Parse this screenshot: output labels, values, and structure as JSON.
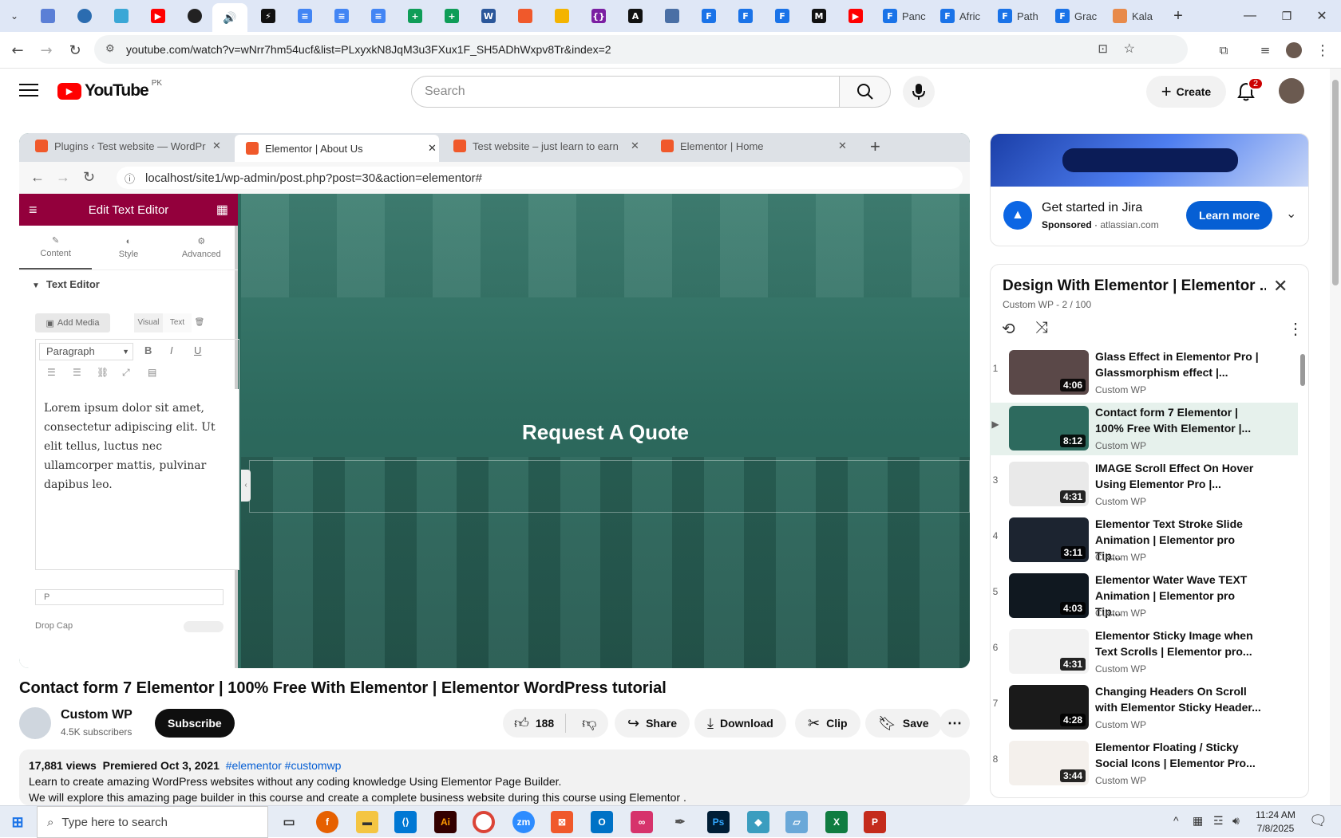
{
  "browser": {
    "url": "youtube.com/watch?v=wNrr7hm54ucf&list=PLxyxkN8JqM3u3FXux1F_SH5ADhWxpv8Tr&index=2",
    "tabs": [
      "Panc",
      "Afric",
      "Path",
      "Grac",
      "Kala"
    ]
  },
  "youtube": {
    "logo": "YouTube",
    "region": "PK",
    "search_placeholder": "Search",
    "create_label": "Create",
    "notif_count": "2"
  },
  "inner_browser": {
    "tabs": [
      "Plugins ‹ Test website — WordPr",
      "Elementor | About Us",
      "Test website – just learn to earn",
      "Elementor | Home"
    ],
    "url": "localhost/site1/wp-admin/post.php?post=30&action=elementor#"
  },
  "elementor": {
    "panel_title": "Edit Text Editor",
    "tabs": [
      "Content",
      "Style",
      "Advanced"
    ],
    "section": "Text Editor",
    "add_media": "Add Media",
    "visual": "Visual",
    "text": "Text",
    "format": "Paragraph",
    "body": "Lorem ipsum dolor sit amet, consectetur adipiscing elit. Ut elit tellus, luctus nec ullamcorper mattis, pulvinar dapibus leo.",
    "path": "P",
    "drop_cap": "Drop Cap",
    "hero_heading": "Request A Quote"
  },
  "video": {
    "title": "Contact form 7 Elementor | 100% Free With Elementor | Elementor WordPress tutorial",
    "channel": "Custom WP",
    "subscribers": "4.5K subscribers",
    "subscribe": "Subscribe",
    "likes": "188",
    "share": "Share",
    "download": "Download",
    "clip": "Clip",
    "save": "Save",
    "views": "17,881 views",
    "premiered": "Premiered Oct 3, 2021",
    "tags": "#elementor #customwp",
    "desc1": "Learn to create amazing WordPress websites without any coding knowledge Using Elementor Page Builder.",
    "desc2": "We will explore this amazing page builder in this course and create a complete business website during this course using Elementor ."
  },
  "ad": {
    "title": "Get started in Jira",
    "sponsored": "Sponsored",
    "domain": "atlassian.com",
    "cta": "Learn more"
  },
  "playlist": {
    "title": "Design With Elementor | Elementor ...",
    "meta": "Custom WP - 2 / 100",
    "items": [
      {
        "num": "1",
        "title": "Glass Effect in Elementor Pro | Glassmorphism effect |...",
        "channel": "Custom WP",
        "dur": "4:06",
        "color": "#5a4848"
      },
      {
        "num": "▶",
        "title": "Contact form 7 Elementor | 100% Free With Elementor |...",
        "channel": "Custom WP",
        "dur": "8:12",
        "color": "#2d6a5e"
      },
      {
        "num": "3",
        "title": "IMAGE Scroll Effect On Hover Using Elementor Pro |...",
        "channel": "Custom WP",
        "dur": "4:31",
        "color": "#e9e9e9"
      },
      {
        "num": "4",
        "title": "Elementor Text Stroke Slide Animation | Elementor pro Tip...",
        "channel": "Custom WP",
        "dur": "3:11",
        "color": "#1c2430"
      },
      {
        "num": "5",
        "title": "Elementor Water Wave TEXT Animation | Elementor pro Tip...",
        "channel": "Custom WP",
        "dur": "4:03",
        "color": "#101820"
      },
      {
        "num": "6",
        "title": "Elementor Sticky Image when Text Scrolls | Elementor pro...",
        "channel": "Custom WP",
        "dur": "4:31",
        "color": "#f2f2f2"
      },
      {
        "num": "7",
        "title": "Changing Headers On Scroll with Elementor Sticky Header...",
        "channel": "Custom WP",
        "dur": "4:28",
        "color": "#1a1a1a"
      },
      {
        "num": "8",
        "title": "Elementor Floating / Sticky Social Icons | Elementor Pro...",
        "channel": "Custom WP",
        "dur": "3:44",
        "color": "#f4f0ec"
      }
    ]
  },
  "taskbar": {
    "search": "Type here to search",
    "time": "11:24 AM",
    "date": "7/8/2025"
  }
}
